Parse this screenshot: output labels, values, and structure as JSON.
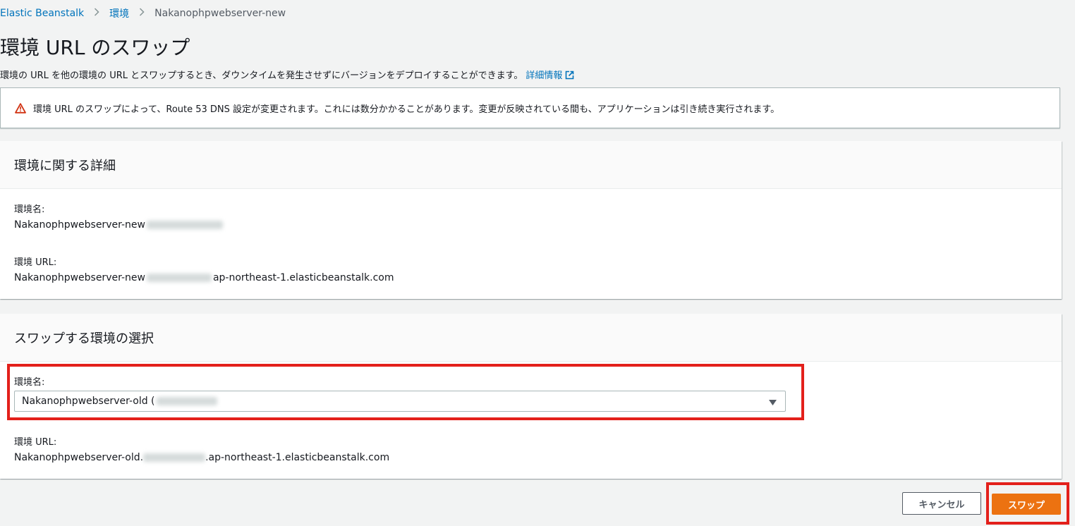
{
  "breadcrumb": {
    "items": [
      "Elastic Beanstalk",
      "環境"
    ],
    "current": "Nakanophpwebserver-new"
  },
  "page": {
    "title": "環境 URL のスワップ",
    "description": "環境の URL を他の環境の URL とスワップするとき、ダウンタイムを発生させずにバージョンをデプロイすることができます。",
    "info_link": "詳細情報"
  },
  "alert": {
    "message": "環境 URL のスワップによって、Route 53 DNS 設定が変更されます。これには数分かかることがあります。変更が反映されている間も、アプリケーションは引き続き実行されます。"
  },
  "details": {
    "header": "環境に関する詳細",
    "name_label": "環境名:",
    "name_value": "Nakanophpwebserver-new",
    "url_label": "環境 URL:",
    "url_prefix": "Nakanophpwebserver-new",
    "url_suffix": "ap-northeast-1.elasticbeanstalk.com"
  },
  "swap_target": {
    "header": "スワップする環境の選択",
    "name_label": "環境名:",
    "selected": "Nakanophpwebserver-old (",
    "url_label": "環境 URL:",
    "url_prefix": "Nakanophpwebserver-old.",
    "url_suffix": ".ap-northeast-1.elasticbeanstalk.com"
  },
  "actions": {
    "cancel": "キャンセル",
    "swap": "スワップ"
  },
  "colors": {
    "link": "#0073bb",
    "primary": "#ec7211",
    "warning": "#d13212",
    "highlight": "#e3201b"
  }
}
